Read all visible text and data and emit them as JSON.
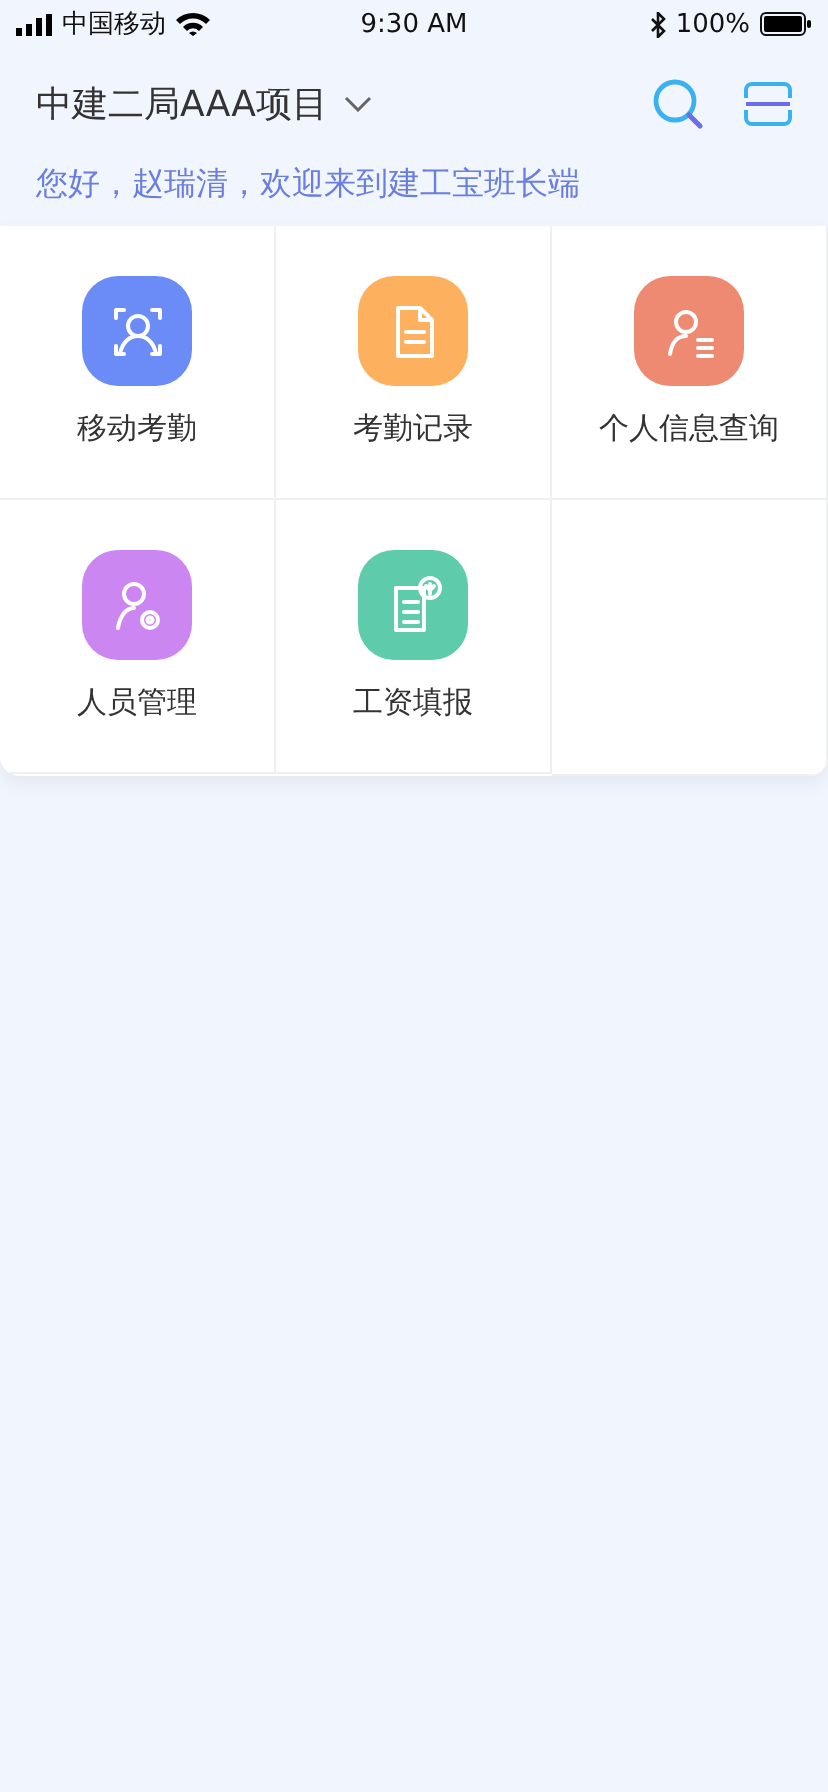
{
  "status_bar": {
    "carrier": "中国移动",
    "time": "9:30 AM",
    "battery": "100%"
  },
  "header": {
    "project": "中建二局AAA项目"
  },
  "greeting": "您好，赵瑞清，欢迎来到建工宝班长端",
  "menu": [
    {
      "label": "移动考勤",
      "kind": "face-scan",
      "color": "#6b8cf7"
    },
    {
      "label": "考勤记录",
      "kind": "document",
      "color": "#fdb05e"
    },
    {
      "label": "个人信息查询",
      "kind": "person-list",
      "color": "#ee8a72"
    },
    {
      "label": "人员管理",
      "kind": "person-gear",
      "color": "#cb86f2"
    },
    {
      "label": "工资填报",
      "kind": "payroll",
      "color": "#5ecbab"
    }
  ]
}
